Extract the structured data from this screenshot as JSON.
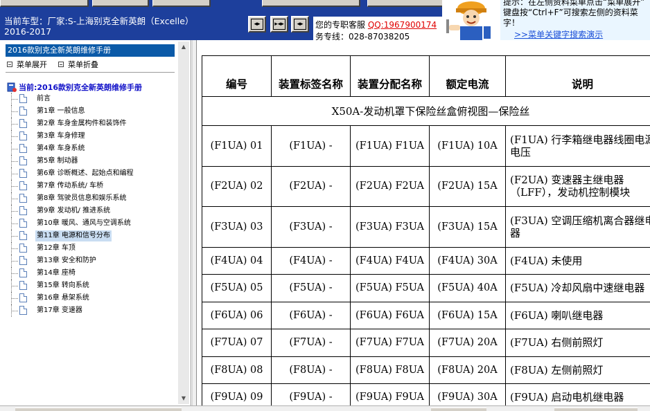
{
  "header": {
    "vehicle_line1": "当前车型：厂家:S-上海别克全新英朗（Excelle）",
    "vehicle_line2": "2016-2017",
    "nav_first_glyph": "◂▸",
    "nav_prev_glyph": "▸◂▸",
    "nav_next_glyph": "◂▸",
    "contact_label": "您的专职客服",
    "contact_qq": "QQ:1967900174",
    "contact_line2": "务专线：028-87038205",
    "tip_line1": "提示：在左侧资料菜单点击“菜单展开”",
    "tip_line2": "键盘按“Ctrl+F”可搜索左侧的资料菜",
    "tip_line3": "字！",
    "tip_link": ">>菜单关键字搜索演示",
    "colors": {
      "header_bg": "#1d3f9c",
      "qq_red": "#e00000",
      "link_blue": "#1a4fd8"
    }
  },
  "sidebar": {
    "title": "2016款别克全新英朗维修手册",
    "expand_all": "菜单展开",
    "collapse_all": "菜单折叠",
    "root_label": "当前:2016款别克全新英朗维修手册",
    "items": [
      {
        "label": "前言"
      },
      {
        "label": "第1章  一般信息"
      },
      {
        "label": "第2章  车身金属构件和装饰件"
      },
      {
        "label": "第3章  车身修理"
      },
      {
        "label": "第4章  车身系统"
      },
      {
        "label": "第5章  制动器"
      },
      {
        "label": "第6章  诊断概述、起始点和编程"
      },
      {
        "label": "第7章  传动系统/ 车桥"
      },
      {
        "label": "第8章  驾驶员信息和娱乐系统"
      },
      {
        "label": "第9章  发动机/ 推进系统"
      },
      {
        "label": "第10章  暖风、通风与空调系统"
      },
      {
        "label": "第11章  电源和信号分布"
      },
      {
        "label": "第12章  车顶"
      },
      {
        "label": "第13章  安全和防护"
      },
      {
        "label": "第14章  座椅"
      },
      {
        "label": "第15章  转向系统"
      },
      {
        "label": "第16章  悬架系统"
      },
      {
        "label": "第17章  变速器"
      }
    ],
    "selected_index": 11
  },
  "table": {
    "headers": [
      "编号",
      "装置标签名称",
      "装置分配名称",
      "额定电流",
      "说明"
    ],
    "section_title": "X50A-发动机罩下保险丝盒俯视图—保险丝",
    "rows": [
      {
        "id": "(F1UA) 01",
        "label": "(F1UA) -",
        "assign": "(F1UA) F1UA",
        "current": "(F1UA) 10A",
        "desc": "(F1UA) 行李箱继电器线圈电源电压",
        "tall": true
      },
      {
        "id": "(F2UA) 02",
        "label": "(F2UA) -",
        "assign": "(F2UA) F2UA",
        "current": "(F2UA) 15A",
        "desc": "(F2UA) 变速器主继电器（LFF），发动机控制模块",
        "tall": true
      },
      {
        "id": "(F3UA) 03",
        "label": "(F3UA) -",
        "assign": "(F3UA) F3UA",
        "current": "(F3UA) 15A",
        "desc": "(F3UA) 空调压缩机离合器继电器",
        "tall": true
      },
      {
        "id": "(F4UA) 04",
        "label": "(F4UA) -",
        "assign": "(F4UA) F4UA",
        "current": "(F4UA) 30A",
        "desc": "(F4UA) 未使用",
        "tall": false
      },
      {
        "id": "(F5UA) 05",
        "label": "(F5UA) -",
        "assign": "(F5UA) F5UA",
        "current": "(F5UA) 40A",
        "desc": "(F5UA) 冷却风扇中速继电器",
        "tall": false
      },
      {
        "id": "(F6UA) 06",
        "label": "(F6UA) -",
        "assign": "(F6UA) F6UA",
        "current": "(F6UA) 15A",
        "desc": "(F6UA) 喇叭继电器",
        "tall": false
      },
      {
        "id": "(F7UA) 07",
        "label": "(F7UA) -",
        "assign": "(F7UA) F7UA",
        "current": "(F7UA) 20A",
        "desc": "(F7UA) 右侧前照灯",
        "tall": false
      },
      {
        "id": "(F8UA) 08",
        "label": "(F8UA) -",
        "assign": "(F8UA) F8UA",
        "current": "(F8UA) 20A",
        "desc": "(F8UA) 左侧前照灯",
        "tall": false
      },
      {
        "id": "(F9UA) 09",
        "label": "(F9UA) -",
        "assign": "(F9UA) F9UA",
        "current": "(F9UA) 30A",
        "desc": "(F9UA) 启动电机继电器",
        "tall": false
      }
    ]
  }
}
